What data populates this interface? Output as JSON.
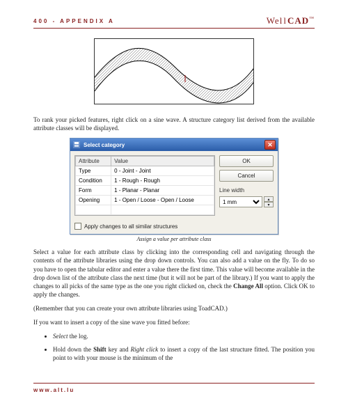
{
  "header": {
    "left": "400 - APPENDIX A",
    "brand_pre": "Wel",
    "brand_sep": "l",
    "brand_post": "CAD",
    "brand_tm": "™"
  },
  "para1": "To rank your picked features, right click on a sine wave. A structure category list derived from the available attribute classes will be displayed.",
  "dialog": {
    "title": "Select category",
    "close_glyph": "✕",
    "columns": {
      "attr": "Attribute",
      "val": "Value"
    },
    "rows": [
      {
        "attr": "Type",
        "val": "0 - Joint - Joint"
      },
      {
        "attr": "Condition",
        "val": "1 - Rough - Rough"
      },
      {
        "attr": "Form",
        "val": "1 - Planar - Planar"
      },
      {
        "attr": "Opening",
        "val": "1 - Open / Loose - Open / Loose"
      }
    ],
    "ok": "OK",
    "cancel": "Cancel",
    "linewidth_label": "Line width",
    "linewidth_value": "1 mm",
    "apply_all": "Apply changes to all similar structures"
  },
  "caption": "Assign a value per attribute class",
  "para2_pre": "Select a value for each attribute class by clicking into the corresponding cell and navigating through the contents of the attribute libraries using the drop down controls. You can also add a value on the fly. To do so you have to open the tabular editor and enter a value there the first time. This value will become available in the drop down list of the attribute class the next time (but it will not be part of the library.)  If you want to apply the changes to all picks of the same type as the one you right clicked on, check the ",
  "para2_bold": "Change All",
  "para2_post": " option. Click OK to apply the changes.",
  "para3": "(Remember that you can create your own attribute libraries using ToadCAD.)",
  "para4": "If you want to insert a copy of the sine wave you fitted before:",
  "bullets": {
    "b1_italic": "Select",
    "b1_rest": " the log.",
    "b2_pre": "Hold down the ",
    "b2_bold1": "Shift",
    "b2_mid": " key and ",
    "b2_italic": "Right click",
    "b2_post": " to insert a copy of the last structure fitted. The position you point to with your mouse is the minimum of the"
  },
  "footer": {
    "url": "www.alt.lu"
  }
}
